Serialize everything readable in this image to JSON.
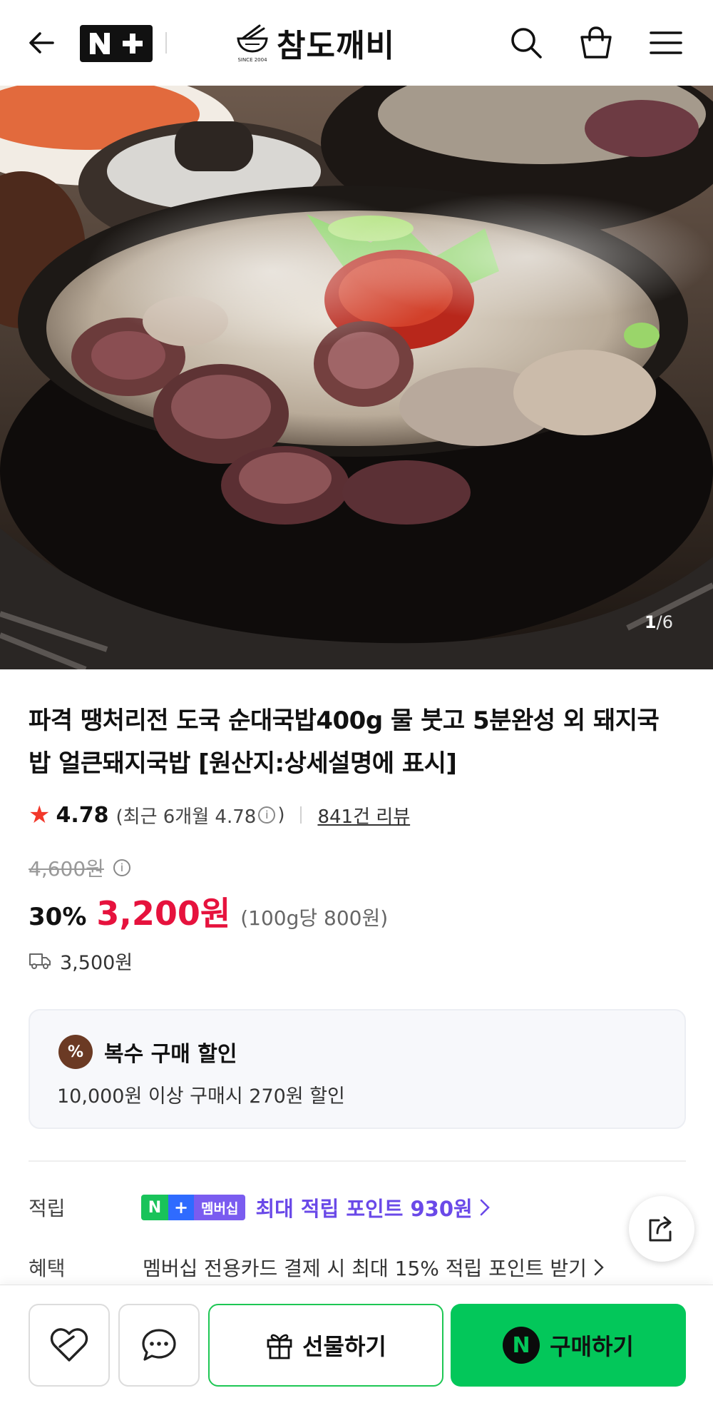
{
  "header": {
    "back_icon": "arrow-left-icon",
    "logo_name": "N+",
    "brand_name": "참도깨비",
    "brand_since": "SINCE 2004",
    "search_icon": "search-icon",
    "cart_icon": "shopping-bag-icon",
    "menu_icon": "hamburger-menu-icon"
  },
  "gallery": {
    "current": "1",
    "separator": "/",
    "total": "6"
  },
  "product": {
    "title": "파격 땡처리전 도국 순대국밥400g 물 붓고 5분완성 외 돼지국밥 얼큰돼지국밥 [원산지:상세설명에 표시]",
    "rating": {
      "score": "4.78",
      "recent_prefix": "(최근 6개월 4.78",
      "recent_suffix": ")",
      "reviews_link": "841건 리뷰"
    },
    "original_price": "4,600원",
    "discount_rate": "30%",
    "sale_price": "3,200원",
    "unit_price": "(100g당 800원)",
    "shipping_fee": "3,500원"
  },
  "multi_buy": {
    "badge": "%",
    "title": "복수 구매 할인",
    "description": "10,000원 이상 구매시 270원 할인"
  },
  "benefits": {
    "points_label": "적립",
    "membership_badge": {
      "n": "N",
      "plus": "+",
      "text": "멤버십"
    },
    "points_text": "최대 적립 포인트 930원",
    "benefit_label": "혜택",
    "benefit_text": "멤버십 전용카드 결제 시 최대 15% 적립 포인트 받기"
  },
  "bottom_bar": {
    "gift_label": "선물하기",
    "buy_label": "구매하기",
    "buy_mark": "N"
  },
  "colors": {
    "sale_red": "#e6123d",
    "naver_green": "#03c75a",
    "membership_purple": "#6a49e8",
    "star_red": "#f2382b"
  }
}
